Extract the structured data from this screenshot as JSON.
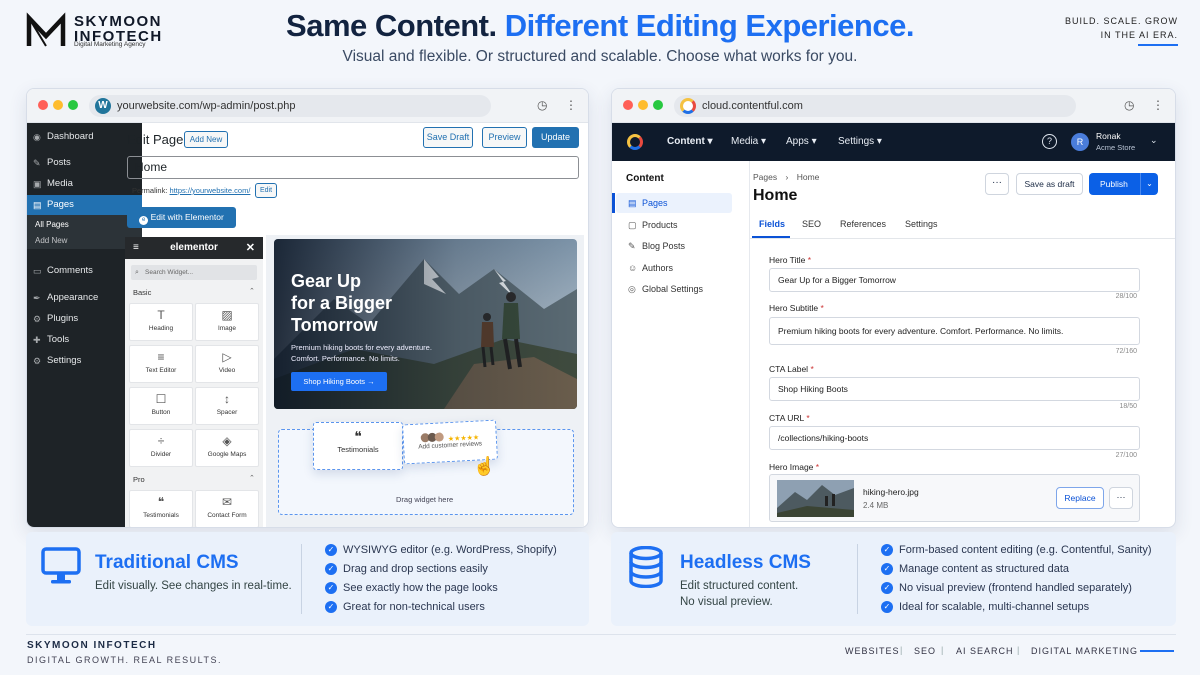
{
  "brand": {
    "name": "SKYMOON INFOTECH",
    "tagline": "Digital Marketing Agency",
    "slogan_line1": "BUILD. SCALE. GROW",
    "slogan_line2": "IN THE AI ERA."
  },
  "headline": {
    "part1": "Same Content.",
    "part2": "Different Editing Experience.",
    "subhead": "Visual and flexible. Or structured and scalable. Choose what works for you."
  },
  "wp": {
    "url": "yourwebsite.com/wp-admin/post.php",
    "sidebar": [
      {
        "label": "Dashboard",
        "icon": "dashboard-icon"
      },
      {
        "label": "Posts",
        "icon": "pin-icon"
      },
      {
        "label": "Media",
        "icon": "media-icon"
      },
      {
        "label": "Pages",
        "icon": "pages-icon"
      },
      {
        "label": "Comments",
        "icon": "comments-icon"
      },
      {
        "label": "Appearance",
        "icon": "appearance-icon"
      },
      {
        "label": "Plugins",
        "icon": "plugins-icon"
      },
      {
        "label": "Tools",
        "icon": "tools-icon"
      },
      {
        "label": "Settings",
        "icon": "settings-icon"
      }
    ],
    "sub_all_pages": "All Pages",
    "sub_add_new": "Add New",
    "edit_title": "Edit Page",
    "add_new_btn": "Add New",
    "save_draft": "Save Draft",
    "preview": "Preview",
    "update": "Update",
    "title_value": "Home",
    "permalink_label": "Permalink:",
    "permalink_url": "https://yourwebsite.com/",
    "permalink_edit": "Edit",
    "edit_with_elementor": "Edit with Elementor",
    "elementor": {
      "title": "elementor",
      "search_placeholder": "Search Widget...",
      "basic_label": "Basic",
      "pro_label": "Pro",
      "widgets": [
        {
          "label": "Heading",
          "icon": "T"
        },
        {
          "label": "Image",
          "icon": "▨"
        },
        {
          "label": "Text Editor",
          "icon": "≡"
        },
        {
          "label": "Video",
          "icon": "▷"
        },
        {
          "label": "Button",
          "icon": "☐"
        },
        {
          "label": "Spacer",
          "icon": "↕"
        },
        {
          "label": "Divider",
          "icon": "÷"
        },
        {
          "label": "Google Maps",
          "icon": "◈"
        }
      ],
      "pro_widgets": [
        {
          "label": "Testimonials",
          "icon": "❝"
        },
        {
          "label": "Contact Form",
          "icon": "✉"
        }
      ]
    },
    "hero": {
      "title_l1": "Gear Up",
      "title_l2": "for a Bigger",
      "title_l3": "Tomorrow",
      "subtitle_l1": "Premium hiking boots for every adventure.",
      "subtitle_l2": "Comfort. Performance. No limits.",
      "cta": "Shop Hiking Boots →"
    },
    "dropzone": {
      "testimonials": "Testimonials",
      "reviews": "Add customer reviews",
      "stars": "★★★★★",
      "drag_text": "Drag widget here"
    }
  },
  "cf": {
    "url": "cloud.contentful.com",
    "nav": [
      "Content",
      "Media",
      "Apps",
      "Settings"
    ],
    "user_name": "Ronak",
    "user_org": "Acme Store",
    "avatar": "R",
    "sidebar_title": "Content",
    "sidebar": [
      {
        "label": "Pages",
        "icon": "pages-icon"
      },
      {
        "label": "Products",
        "icon": "products-icon"
      },
      {
        "label": "Blog Posts",
        "icon": "blog-icon"
      },
      {
        "label": "Authors",
        "icon": "authors-icon"
      },
      {
        "label": "Global Settings",
        "icon": "globe-icon"
      }
    ],
    "breadcrumb_root": "Pages",
    "breadcrumb_leaf": "Home",
    "page_title": "Home",
    "more": "···",
    "save_as_draft": "Save as draft",
    "publish": "Publish",
    "tabs": [
      "Fields",
      "SEO",
      "References",
      "Settings"
    ],
    "fields": [
      {
        "label": "Hero Title",
        "value": "Gear Up for a Bigger Tomorrow",
        "counter": "28/100"
      },
      {
        "label": "Hero Subtitle",
        "value": "Premium hiking boots for every adventure. Comfort. Performance. No limits.",
        "counter": "72/160"
      },
      {
        "label": "CTA Label",
        "value": "Shop Hiking Boots",
        "counter": "18/50"
      },
      {
        "label": "CTA URL",
        "value": "/collections/hiking-boots",
        "counter": "27/100"
      }
    ],
    "hero_image_label": "Hero Image",
    "image_name": "hiking-hero.jpg",
    "image_size": "2.4 MB",
    "replace": "Replace"
  },
  "traditional": {
    "title": "Traditional CMS",
    "desc": "Edit visually. See changes in real-time.",
    "bullets": [
      "WYSIWYG editor (e.g. WordPress, Shopify)",
      "Drag and drop sections easily",
      "See exactly how the page looks",
      "Great for non-technical users"
    ]
  },
  "headless": {
    "title": "Headless CMS",
    "desc_l1": "Edit structured content.",
    "desc_l2": "No visual preview.",
    "bullets": [
      "Form-based content editing (e.g. Contentful, Sanity)",
      "Manage content as structured data",
      "No visual preview (frontend handled separately)",
      "Ideal for scalable, multi-channel setups"
    ]
  },
  "footer": {
    "brand": "SKYMOON INFOTECH",
    "tagline": "DIGITAL GROWTH. REAL RESULTS.",
    "nav": [
      "WEBSITES",
      "SEO",
      "AI SEARCH",
      "DIGITAL MARKETING"
    ]
  },
  "colors": {
    "accent": "#1d6ff2",
    "wp_blue": "#2271b1",
    "wp_dark": "#1e2327",
    "cf_dark": "#0e1a2b"
  }
}
